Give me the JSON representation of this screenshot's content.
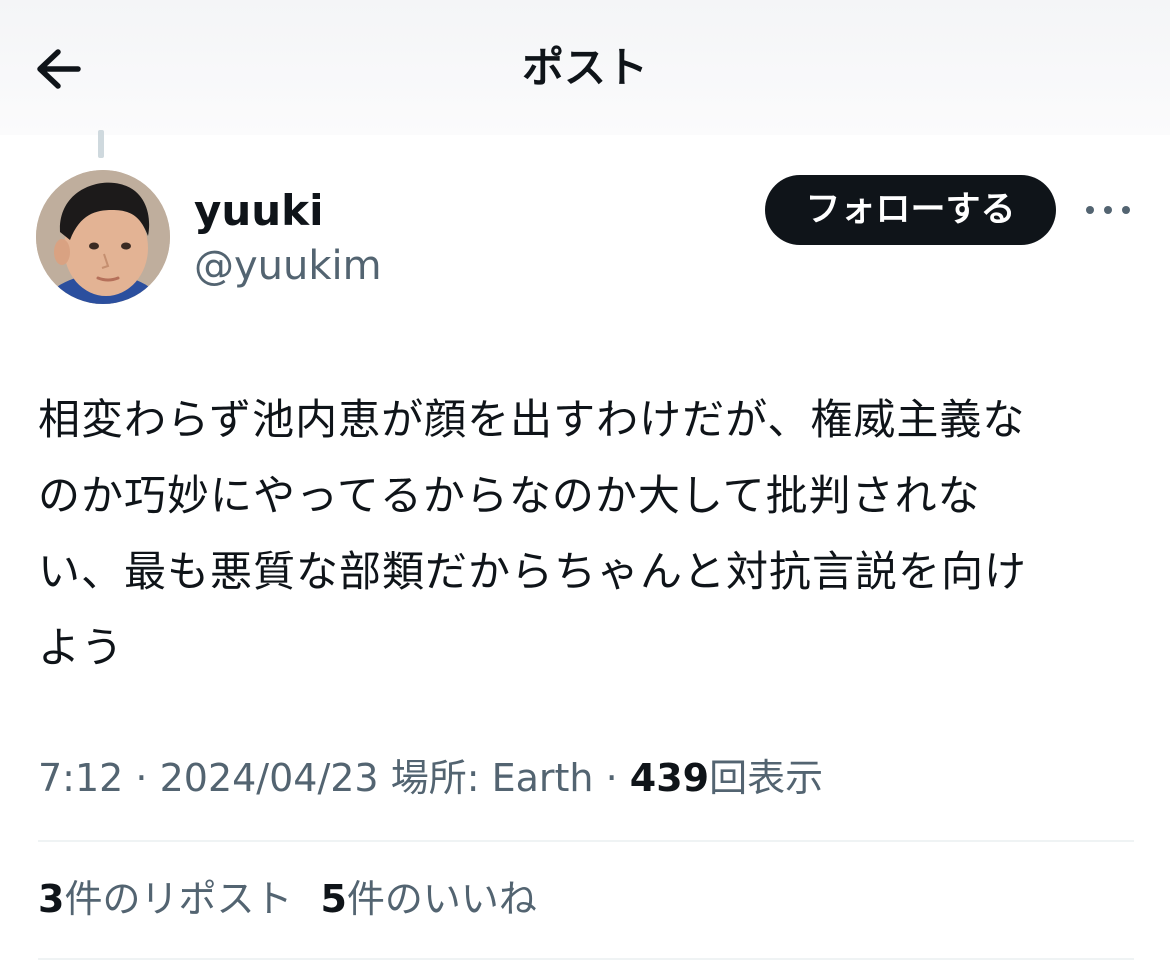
{
  "header": {
    "title": "ポスト",
    "back_icon": "arrow-left-icon"
  },
  "author": {
    "display_name": "yuuki",
    "handle": "@yuukim",
    "avatar": "child-portrait-avatar"
  },
  "actions": {
    "follow_label": "フォローする",
    "more_icon": "more-horizontal-icon"
  },
  "tweet": {
    "text": "相変わらず池内恵が顔を出すわけだが、権威主義な\nのか巧妙にやってるからなのか大して批判されな\nい、最も悪質な部類だからちゃんと対抗言説を向け\nよう"
  },
  "meta": {
    "time": "7:12",
    "sep1": " · ",
    "date": "2024/04/23",
    "location": "場所: Earth",
    "sep2": " · ",
    "views_count": "439",
    "views_label": "回表示"
  },
  "stats": {
    "reposts_count": "3",
    "reposts_label": "件のリポスト",
    "likes_count": "5",
    "likes_label": "件のいいね"
  },
  "colors": {
    "text_primary": "#0f1419",
    "text_secondary": "#536471",
    "divider": "#eff3f4",
    "button_bg": "#0f1419",
    "button_text": "#ffffff"
  }
}
